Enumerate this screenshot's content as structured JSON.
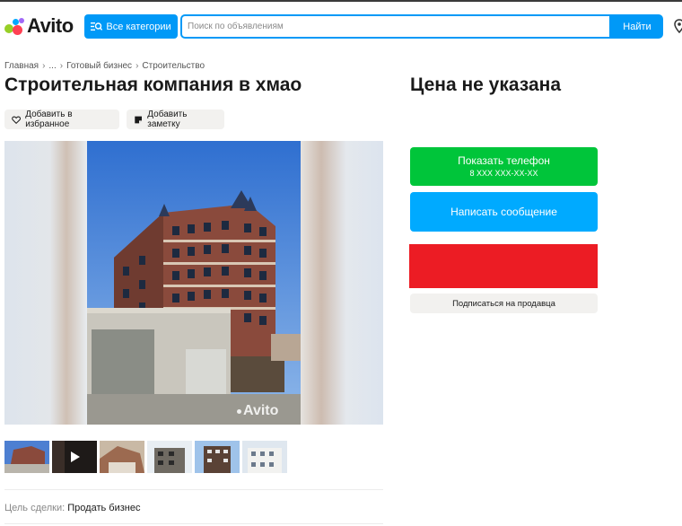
{
  "header": {
    "logo_text": "Avito",
    "categories_label": "Все категории",
    "search_placeholder": "Поиск по объявлениям",
    "search_button": "Найти"
  },
  "breadcrumbs": [
    "Главная",
    "...",
    "Готовый бизнес",
    "Строительство"
  ],
  "listing": {
    "title": "Строительная компания в хмао",
    "price": "Цена не указана",
    "favorite_label": "Добавить в избранное",
    "note_label": "Добавить заметку",
    "watermark": "Avito",
    "deal_label": "Цель сделки:",
    "deal_value": "Продать бизнес"
  },
  "actions": {
    "phone_label": "Показать телефон",
    "phone_number": "8 XXX XXX-XX-XX",
    "message_label": "Написать сообщение",
    "subscribe_label": "Подписаться на продавца"
  },
  "colors": {
    "brand_blue": "#0099f7",
    "phone_green": "#00c53a",
    "message_blue": "#00aaff",
    "red_block": "#ec1c24"
  }
}
